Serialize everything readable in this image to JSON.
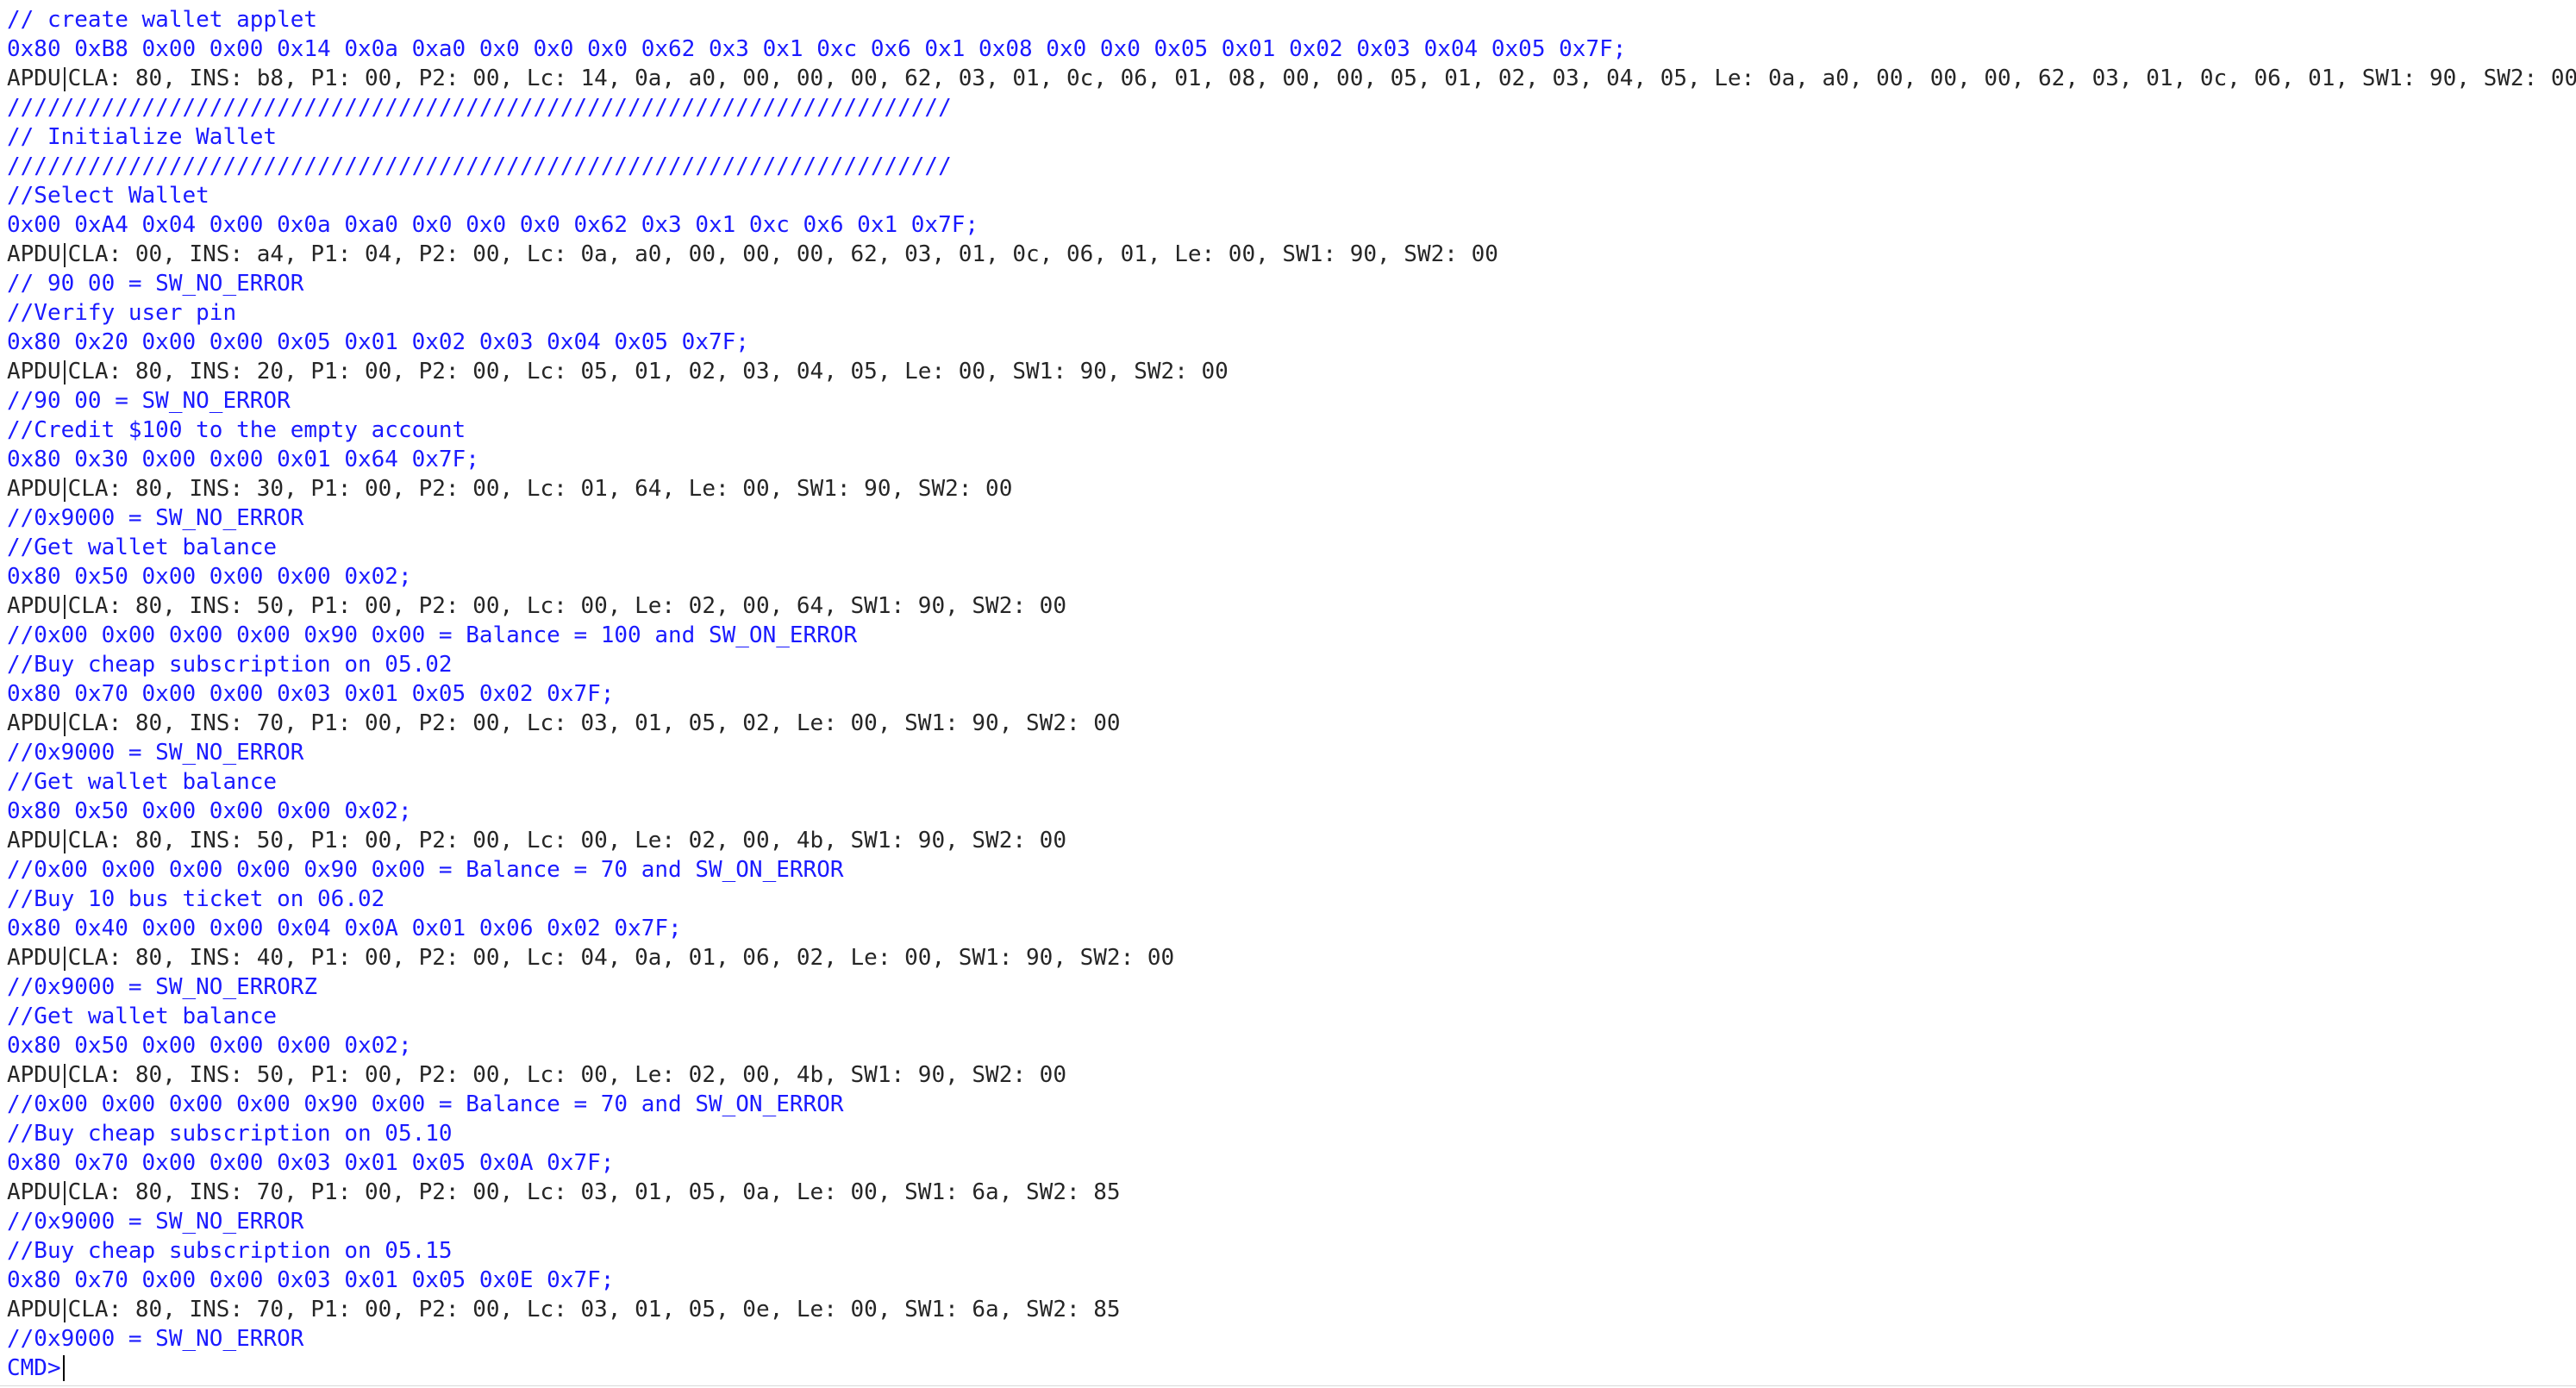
{
  "console": {
    "lines": [
      {
        "kind": "cmd",
        "text": "// create wallet applet"
      },
      {
        "kind": "cmd",
        "text": "0x80 0xB8 0x00 0x00 0x14 0x0a 0xa0 0x0 0x0 0x0 0x62 0x3 0x1 0xc 0x6 0x1 0x08 0x0 0x0 0x05 0x01 0x02 0x03 0x04 0x05 0x7F;"
      },
      {
        "kind": "resp",
        "prefix": "APDU",
        "text": "CLA: 80, INS: b8, P1: 00, P2: 00, Lc: 14, 0a, a0, 00, 00, 00, 62, 03, 01, 0c, 06, 01, 08, 00, 00, 05, 01, 02, 03, 04, 05, Le: 0a, a0, 00, 00, 00, 62, 03, 01, 0c, 06, 01, SW1: 90, SW2: 00"
      },
      {
        "kind": "cmd",
        "text": "//////////////////////////////////////////////////////////////////////"
      },
      {
        "kind": "cmd",
        "text": "// Initialize Wallet"
      },
      {
        "kind": "cmd",
        "text": "//////////////////////////////////////////////////////////////////////"
      },
      {
        "kind": "cmd",
        "text": "//Select Wallet"
      },
      {
        "kind": "cmd",
        "text": "0x00 0xA4 0x04 0x00 0x0a 0xa0 0x0 0x0 0x0 0x62 0x3 0x1 0xc 0x6 0x1 0x7F;"
      },
      {
        "kind": "resp",
        "prefix": "APDU",
        "text": "CLA: 00, INS: a4, P1: 04, P2: 00, Lc: 0a, a0, 00, 00, 00, 62, 03, 01, 0c, 06, 01, Le: 00, SW1: 90, SW2: 00"
      },
      {
        "kind": "cmd",
        "text": "// 90 00 = SW_NO_ERROR"
      },
      {
        "kind": "cmd",
        "text": "//Verify user pin"
      },
      {
        "kind": "cmd",
        "text": "0x80 0x20 0x00 0x00 0x05 0x01 0x02 0x03 0x04 0x05 0x7F;"
      },
      {
        "kind": "resp",
        "prefix": "APDU",
        "text": "CLA: 80, INS: 20, P1: 00, P2: 00, Lc: 05, 01, 02, 03, 04, 05, Le: 00, SW1: 90, SW2: 00"
      },
      {
        "kind": "cmd",
        "text": "//90 00 = SW_NO_ERROR"
      },
      {
        "kind": "cmd",
        "text": "//Credit $100 to the empty account"
      },
      {
        "kind": "cmd",
        "text": "0x80 0x30 0x00 0x00 0x01 0x64 0x7F;"
      },
      {
        "kind": "resp",
        "prefix": "APDU",
        "text": "CLA: 80, INS: 30, P1: 00, P2: 00, Lc: 01, 64, Le: 00, SW1: 90, SW2: 00"
      },
      {
        "kind": "cmd",
        "text": "//0x9000 = SW_NO_ERROR"
      },
      {
        "kind": "cmd",
        "text": "//Get wallet balance"
      },
      {
        "kind": "cmd",
        "text": "0x80 0x50 0x00 0x00 0x00 0x02;"
      },
      {
        "kind": "resp",
        "prefix": "APDU",
        "text": "CLA: 80, INS: 50, P1: 00, P2: 00, Lc: 00, Le: 02, 00, 64, SW1: 90, SW2: 00"
      },
      {
        "kind": "cmd",
        "text": "//0x00 0x00 0x00 0x00 0x90 0x00 = Balance = 100 and SW_ON_ERROR"
      },
      {
        "kind": "cmd",
        "text": "//Buy cheap subscription on 05.02"
      },
      {
        "kind": "cmd",
        "text": "0x80 0x70 0x00 0x00 0x03 0x01 0x05 0x02 0x7F;"
      },
      {
        "kind": "resp",
        "prefix": "APDU",
        "text": "CLA: 80, INS: 70, P1: 00, P2: 00, Lc: 03, 01, 05, 02, Le: 00, SW1: 90, SW2: 00"
      },
      {
        "kind": "cmd",
        "text": "//0x9000 = SW_NO_ERROR"
      },
      {
        "kind": "cmd",
        "text": "//Get wallet balance"
      },
      {
        "kind": "cmd",
        "text": "0x80 0x50 0x00 0x00 0x00 0x02;"
      },
      {
        "kind": "resp",
        "prefix": "APDU",
        "text": "CLA: 80, INS: 50, P1: 00, P2: 00, Lc: 00, Le: 02, 00, 4b, SW1: 90, SW2: 00"
      },
      {
        "kind": "cmd",
        "text": "//0x00 0x00 0x00 0x00 0x90 0x00 = Balance = 70 and SW_ON_ERROR"
      },
      {
        "kind": "cmd",
        "text": "//Buy 10 bus ticket on 06.02"
      },
      {
        "kind": "cmd",
        "text": "0x80 0x40 0x00 0x00 0x04 0x0A 0x01 0x06 0x02 0x7F;"
      },
      {
        "kind": "resp",
        "prefix": "APDU",
        "text": "CLA: 80, INS: 40, P1: 00, P2: 00, Lc: 04, 0a, 01, 06, 02, Le: 00, SW1: 90, SW2: 00"
      },
      {
        "kind": "cmd",
        "text": "//0x9000 = SW_NO_ERRORZ"
      },
      {
        "kind": "cmd",
        "text": "//Get wallet balance"
      },
      {
        "kind": "cmd",
        "text": "0x80 0x50 0x00 0x00 0x00 0x02;"
      },
      {
        "kind": "resp",
        "prefix": "APDU",
        "text": "CLA: 80, INS: 50, P1: 00, P2: 00, Lc: 00, Le: 02, 00, 4b, SW1: 90, SW2: 00"
      },
      {
        "kind": "cmd",
        "text": "//0x00 0x00 0x00 0x00 0x90 0x00 = Balance = 70 and SW_ON_ERROR"
      },
      {
        "kind": "cmd",
        "text": "//Buy cheap subscription on 05.10"
      },
      {
        "kind": "cmd",
        "text": "0x80 0x70 0x00 0x00 0x03 0x01 0x05 0x0A 0x7F;"
      },
      {
        "kind": "resp",
        "prefix": "APDU",
        "text": "CLA: 80, INS: 70, P1: 00, P2: 00, Lc: 03, 01, 05, 0a, Le: 00, SW1: 6a, SW2: 85"
      },
      {
        "kind": "cmd",
        "text": "//0x9000 = SW_NO_ERROR"
      },
      {
        "kind": "cmd",
        "text": "//Buy cheap subscription on 05.15"
      },
      {
        "kind": "cmd",
        "text": "0x80 0x70 0x00 0x00 0x03 0x01 0x05 0x0E 0x7F;"
      },
      {
        "kind": "resp",
        "prefix": "APDU",
        "text": "CLA: 80, INS: 70, P1: 00, P2: 00, Lc: 03, 01, 05, 0e, Le: 00, SW1: 6a, SW2: 85"
      },
      {
        "kind": "cmd",
        "text": "//0x9000 = SW_NO_ERROR"
      }
    ],
    "prompt": "CMD>",
    "input_value": ""
  },
  "colors": {
    "command": "#1a1aff",
    "response": "#262626",
    "background": "#ffffff"
  }
}
